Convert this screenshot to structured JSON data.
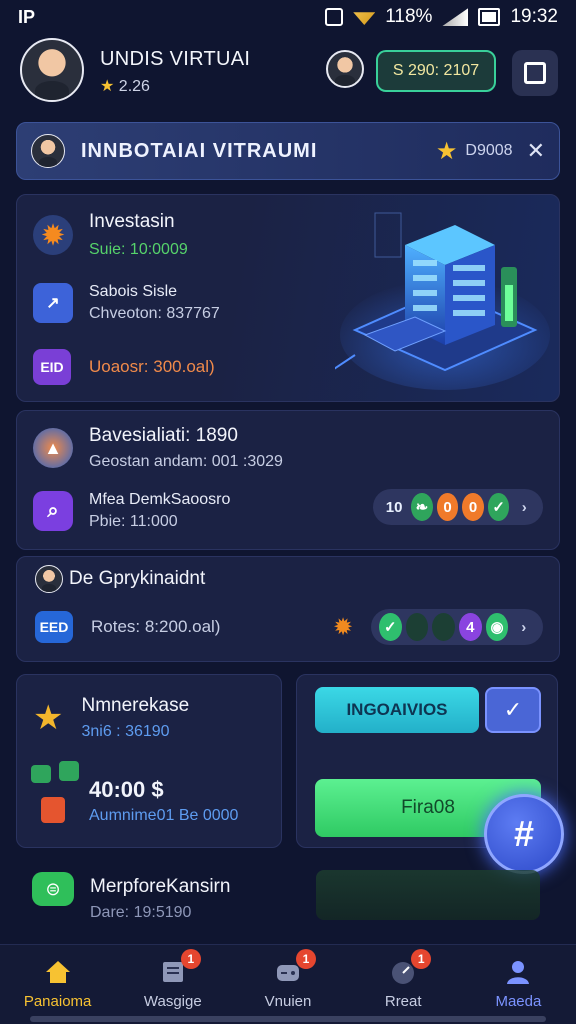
{
  "statusbar": {
    "left": "IP",
    "battery": "118%",
    "time": "19:32"
  },
  "header": {
    "name": "UNDIS VIRTUAI",
    "rating": "2.26",
    "balance": "S 290: 2107"
  },
  "banner": {
    "title": "INNBOTAIAI VITRAUMI",
    "code": "D9008"
  },
  "card1": {
    "title": "Investasin",
    "sub": "Suie: 10:0009",
    "row2_title": "Sabois Sisle",
    "row2_sub": "Chveoton: 837767",
    "row3_icon": "EID",
    "row3_text": "Uoaosr: 300.oal)"
  },
  "card2": {
    "title": "Bavesialiati: 1890",
    "sub": "Geostan andam: 001 :3029",
    "row2_title": "Mfea DemkSaoosro",
    "row2_sub": "Pbie: 11:000",
    "pill": [
      "10",
      "0",
      "0"
    ]
  },
  "card3": {
    "title": "De Gprykinaidnt",
    "row2_icon": "EED",
    "row2_text": "Rotes: 8:200.oal)",
    "pill": [
      "✓",
      "4"
    ]
  },
  "card4": {
    "title": "Nmnerekase",
    "sub": "3ni6 : 36190",
    "amount": "40:00 $",
    "caption": "Aumnime01 Be 0000"
  },
  "card5": {
    "teal_label": "INGOAIVIOS",
    "green_label": "Fira08",
    "arrow_label": "✓"
  },
  "fab": {
    "label": "#"
  },
  "card6": {
    "title": "MerpforeKansirn",
    "sub": "Dare: 19:5190"
  },
  "nav": [
    {
      "label": "Panaioma",
      "badge": ""
    },
    {
      "label": "Wasgige",
      "badge": "1"
    },
    {
      "label": "Vnuien",
      "badge": "1"
    },
    {
      "label": "Rreat",
      "badge": "1"
    },
    {
      "label": "Maeda",
      "badge": ""
    }
  ]
}
